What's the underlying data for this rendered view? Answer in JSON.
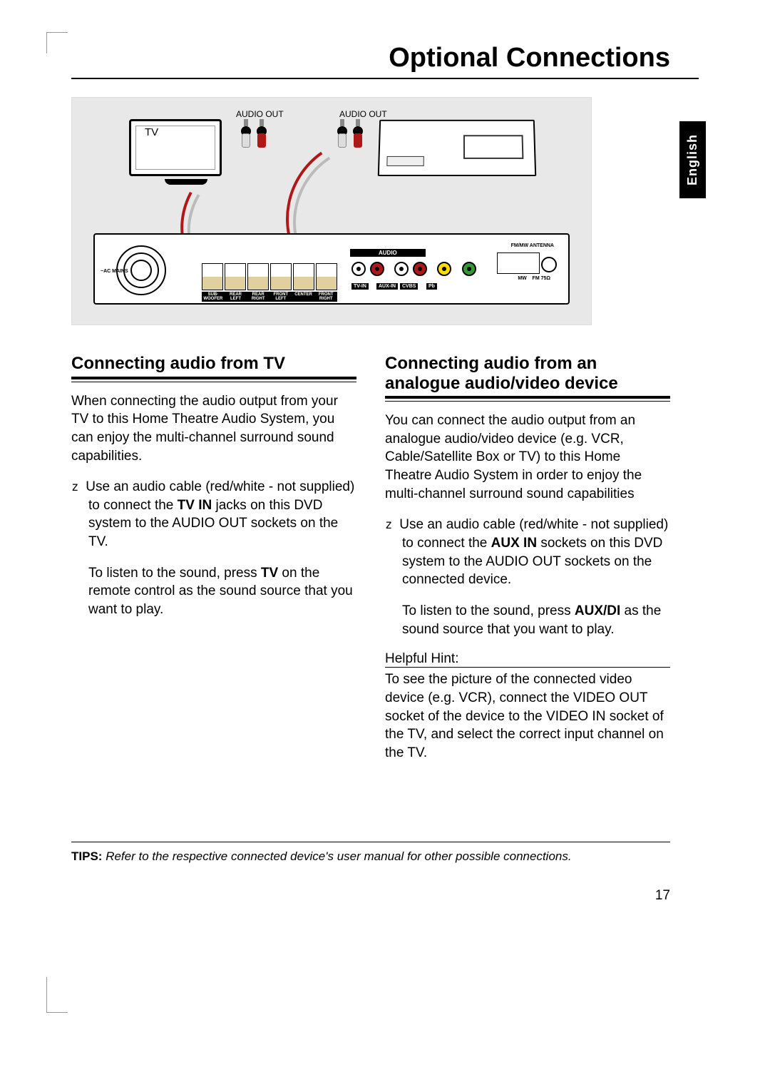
{
  "page": {
    "title": "Optional Connections",
    "language_tab": "English",
    "number": "17"
  },
  "diagram": {
    "tv_label": "TV",
    "audio_out_1": "AUDIO OUT",
    "audio_out_2": "AUDIO OUT",
    "receiver": {
      "ac_mains": "~AC MAINS",
      "audio_banner": "AUDIO",
      "speaker_labels": [
        "SUB-WOOFER",
        "REAR LEFT",
        "REAR RIGHT",
        "FRONT LEFT",
        "CENTER",
        "FRONT RIGHT"
      ],
      "jack_labels": [
        "TV-IN",
        "AUX-IN",
        "CVBS",
        "Pb"
      ],
      "antenna_title": "FM/MW ANTENNA",
      "antenna_sub_mw": "MW",
      "antenna_sub_fm": "FM 75Ω"
    }
  },
  "left": {
    "heading": "Connecting audio from TV",
    "p1": "When connecting the audio output from your TV to this Home Theatre Audio System, you can enjoy the multi-channel surround sound capabilities.",
    "bullet_pre": "Use an audio cable (red/white - not supplied) to connect the ",
    "bullet_bold": "TV IN",
    "bullet_post": " jacks on this DVD system to the AUDIO OUT sockets on the TV.",
    "p2_pre": "To listen to the sound, press ",
    "p2_bold": "TV",
    "p2_post": " on the remote control as the sound source that you want to play."
  },
  "right": {
    "heading": "Connecting audio from an analogue audio/video device",
    "p1": "You can connect the audio output from an analogue audio/video device (e.g. VCR, Cable/Satellite Box or TV) to this Home Theatre Audio System in order to enjoy the multi-channel surround sound capabilities",
    "bullet_pre": "Use an audio cable (red/white - not supplied) to connect the ",
    "bullet_bold": "AUX IN",
    "bullet_post": " sockets on this DVD system to the AUDIO OUT sockets on the connected device.",
    "p2_pre": "To listen to the sound, press ",
    "p2_bold": "AUX/DI",
    "p2_post": " as the sound source that you want to play.",
    "hint_head": "Helpful Hint:",
    "hint_body": "To see the picture of the connected video device (e.g. VCR), connect the VIDEO OUT socket of the device to the VIDEO IN socket of the TV, and select the correct input channel on the TV."
  },
  "tips": {
    "label": "TIPS:",
    "text": "Refer to the respective connected device's user manual for other possible connections."
  }
}
